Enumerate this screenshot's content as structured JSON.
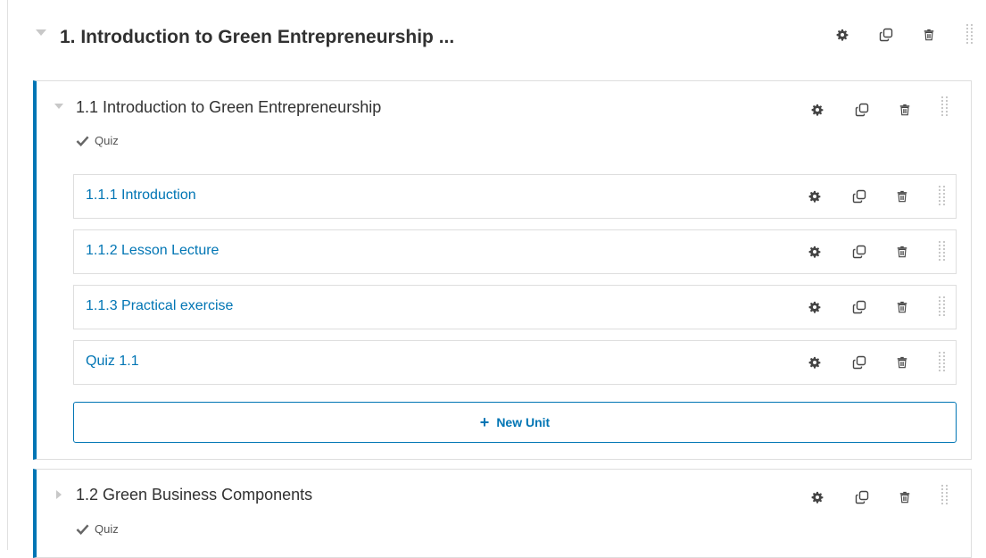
{
  "section": {
    "title": "1. Introduction to Green Entrepreneurship ..."
  },
  "subsections": [
    {
      "title": "1.1 Introduction to Green Entrepreneurship",
      "tag": "Quiz",
      "units": [
        {
          "label": "1.1.1 Introduction"
        },
        {
          "label": "1.1.2 Lesson Lecture"
        },
        {
          "label": "1.1.3 Practical exercise"
        },
        {
          "label": "Quiz 1.1"
        }
      ],
      "new_unit_label": "New Unit"
    },
    {
      "title": "1.2 Green Business Components",
      "tag": "Quiz"
    }
  ],
  "icons": {
    "settings": "gear-icon",
    "duplicate": "duplicate-icon",
    "delete": "trash-icon",
    "drag": "drag-handle-icon",
    "expanded": "caret-down-icon",
    "collapsed": "caret-right-icon",
    "quiz_tag": "checkmark-icon",
    "add": "plus-icon"
  },
  "colors": {
    "accent": "#0075b4",
    "border": "#dedede",
    "text": "#313131",
    "icon": "#444444",
    "muted_icon": "#c8c8c8"
  }
}
